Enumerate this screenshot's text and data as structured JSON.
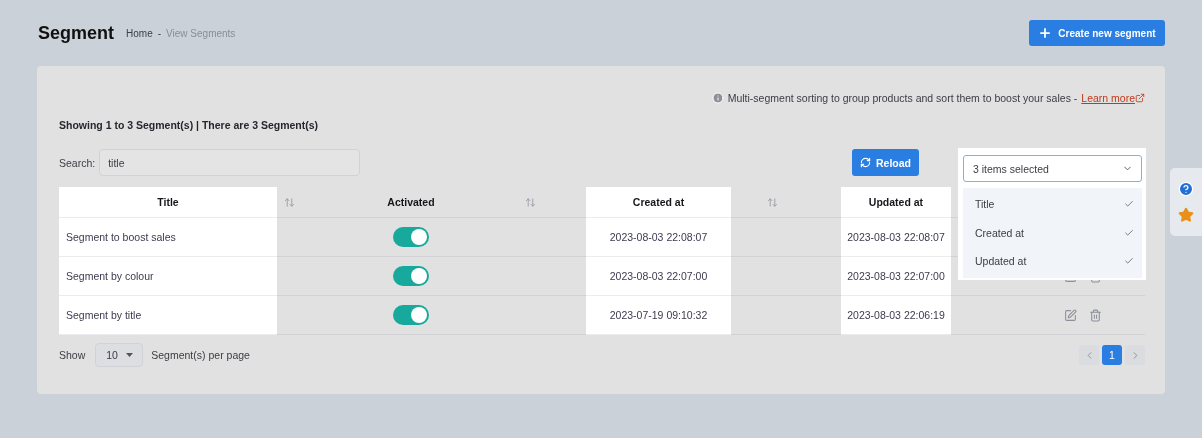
{
  "header": {
    "title": "Segment",
    "breadcrumb": [
      {
        "label": "Home",
        "current": false
      },
      {
        "label": "View Segments",
        "current": true
      }
    ],
    "separator": "-",
    "create_button": "Create new segment"
  },
  "info": {
    "text": "Multi-segment sorting to group products and sort them to boost your sales -",
    "link": "Learn more"
  },
  "summary": "Showing 1 to 3 Segment(s) | There are 3 Segment(s)",
  "search": {
    "label": "Search:",
    "value": "title"
  },
  "reload_button": "Reload",
  "column_picker": {
    "value": "3 items selected",
    "expanded": true,
    "options": [
      {
        "label": "Title",
        "selected": true
      },
      {
        "label": "Created at",
        "selected": true
      },
      {
        "label": "Updated at",
        "selected": true
      }
    ]
  },
  "table": {
    "columns": [
      {
        "label": "Title",
        "highlighted": true,
        "sortable": true
      },
      {
        "label": "Activated",
        "highlighted": false,
        "sortable": true
      },
      {
        "label": "Created at",
        "highlighted": true,
        "sortable": true
      },
      {
        "label": "Updated at",
        "highlighted": true,
        "sortable": false
      }
    ],
    "rows": [
      {
        "title": "Segment to boost sales",
        "activated": true,
        "created_at": "2023-08-03 22:08:07",
        "updated_at": "2023-08-03 22:08:07",
        "actions": false
      },
      {
        "title": "Segment by colour",
        "activated": true,
        "created_at": "2023-08-03 22:07:00",
        "updated_at": "2023-08-03 22:07:00",
        "actions": true
      },
      {
        "title": "Segment by title",
        "activated": true,
        "created_at": "2023-07-19 09:10:32",
        "updated_at": "2023-08-03 22:06:19",
        "actions": true
      }
    ]
  },
  "footer": {
    "show_label": "Show",
    "page_size": "10",
    "per_page_label": "Segment(s) per page",
    "pages": [
      {
        "label": "1",
        "selected": true
      }
    ]
  }
}
